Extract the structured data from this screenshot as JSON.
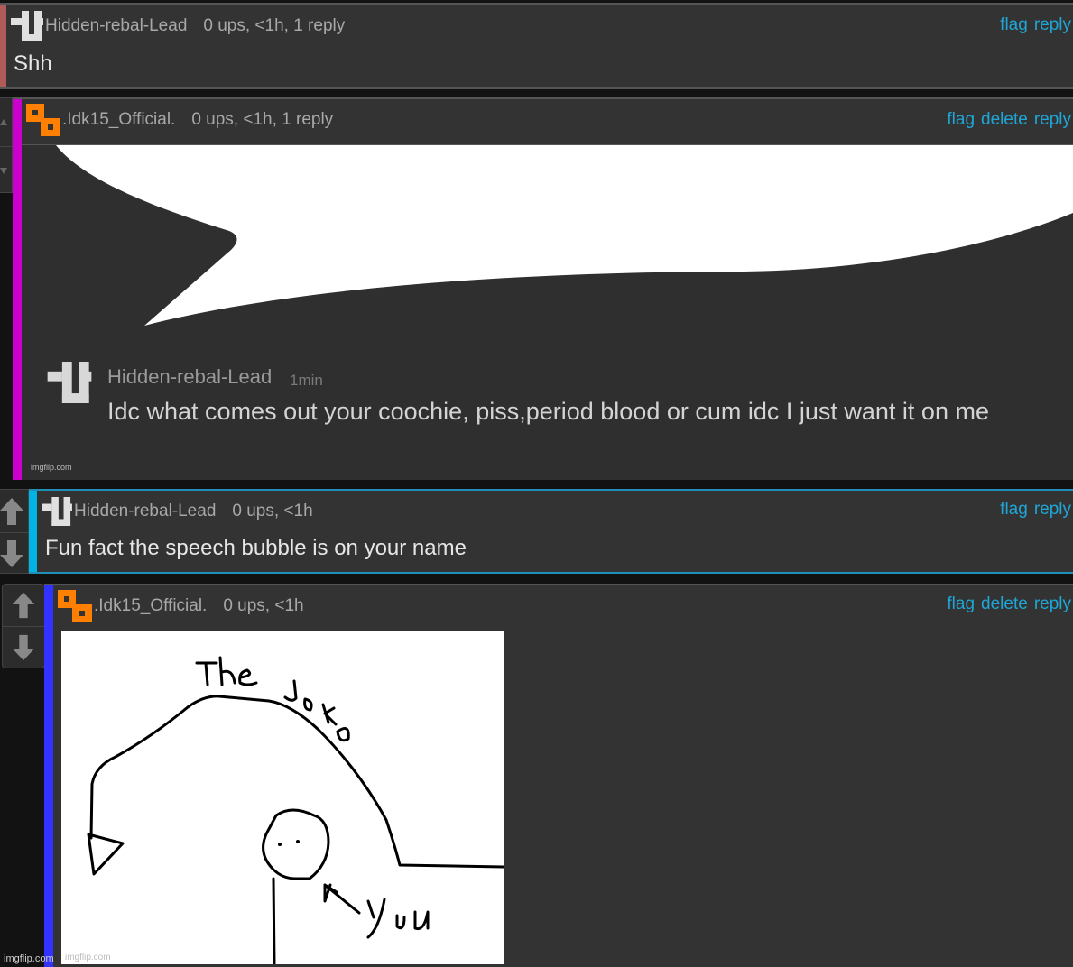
{
  "comments": [
    {
      "username": "Hidden-rebal-Lead",
      "meta": "0 ups, <1h, 1 reply",
      "text": "Shh",
      "actions": [
        "flag",
        "reply"
      ],
      "accent_color": "#b05a5a",
      "avatar": "u-pixel-avatar"
    },
    {
      "username": ".Idk15_Official.",
      "meta": "0 ups, <1h, 1 reply",
      "actions": [
        "flag",
        "delete",
        "reply"
      ],
      "accent_color": "#cc00cc",
      "avatar": "orange-block-avatar",
      "image": {
        "type": "screenshot-meme",
        "inner_username": "Hidden-rebal-Lead",
        "inner_time": "1min",
        "inner_text": "Idc what comes out your coochie, piss,period blood or cum idc I just want it on me",
        "watermark": "imgflip.com"
      }
    },
    {
      "username": "Hidden-rebal-Lead",
      "meta": "0 ups, <1h",
      "text": "Fun fact the speech bubble is on your name",
      "actions": [
        "flag",
        "reply"
      ],
      "accent_color": "#00b4e6",
      "avatar": "u-pixel-avatar"
    },
    {
      "username": ".Idk15_Official.",
      "meta": "0 ups, <1h",
      "actions": [
        "flag",
        "delete",
        "reply"
      ],
      "accent_color": "#3333ff",
      "avatar": "orange-block-avatar",
      "image": {
        "type": "drawing",
        "label_top": "The Joke",
        "label_pointer": "you",
        "watermark": "imgflip.com"
      }
    }
  ],
  "footer_watermark": "imgflip.com",
  "colors": {
    "page_bg": "#121212",
    "card_bg": "#333333",
    "link": "#1fa6d6",
    "muted_text": "#a8a8a8",
    "body_text": "#e6e6e6",
    "avatar_orange": "#ff7f00"
  }
}
